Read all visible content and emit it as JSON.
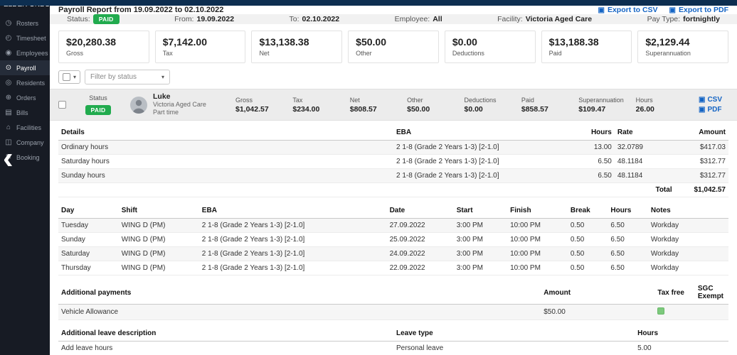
{
  "app": {
    "brand": "ELDER ONBO"
  },
  "icons": {
    "file": "▣",
    "caret_down": "▾",
    "collapse_chevron": "‹"
  },
  "sidebar": {
    "items": [
      {
        "label": "Rosters",
        "icon": "rosters-icon",
        "glyph": "◷"
      },
      {
        "label": "Timesheet",
        "icon": "timesheet-icon",
        "glyph": "◴"
      },
      {
        "label": "Employees",
        "icon": "employees-icon",
        "glyph": "◉"
      },
      {
        "label": "Payroll",
        "icon": "payroll-icon",
        "glyph": "⊙"
      },
      {
        "label": "Residents",
        "icon": "residents-icon",
        "glyph": "◎"
      },
      {
        "label": "Orders",
        "icon": "orders-icon",
        "glyph": "⊕"
      },
      {
        "label": "Bills",
        "icon": "bills-icon",
        "glyph": "▤"
      },
      {
        "label": "Facilities",
        "icon": "facilities-icon",
        "glyph": "⌂"
      },
      {
        "label": "Company",
        "icon": "company-icon",
        "glyph": "◫"
      },
      {
        "label": "Booking",
        "icon": "booking-icon",
        "glyph": "✎"
      }
    ]
  },
  "header": {
    "title": "Payroll Report from 19.09.2022 to 02.10.2022",
    "export_csv": "Export to CSV",
    "export_pdf": "Export to PDF"
  },
  "filters": {
    "status_label": "Status:",
    "status_value": "PAID",
    "from_label": "From:",
    "from_value": "19.09.2022",
    "to_label": "To:",
    "to_value": "02.10.2022",
    "employee_label": "Employee:",
    "employee_value": "All",
    "facility_label": "Facility:",
    "facility_value": "Victoria Aged Care",
    "paytype_label": "Pay Type:",
    "paytype_value": "fortnightly"
  },
  "summary_cards": [
    {
      "value": "$20,280.38",
      "label": "Gross"
    },
    {
      "value": "$7,142.00",
      "label": "Tax"
    },
    {
      "value": "$13,138.38",
      "label": "Net"
    },
    {
      "value": "$50.00",
      "label": "Other"
    },
    {
      "value": "$0.00",
      "label": "Deductions"
    },
    {
      "value": "$13,188.38",
      "label": "Paid"
    },
    {
      "value": "$2,129.44",
      "label": "Superannuation"
    }
  ],
  "toolbar": {
    "filter_placeholder": "Filter by status"
  },
  "employee": {
    "status_label": "Status",
    "status_badge": "PAID",
    "name": "Luke",
    "facility": "Victoria Aged Care",
    "employment": "Part time",
    "metrics": [
      {
        "label": "Gross",
        "value": "$1,042.57"
      },
      {
        "label": "Tax",
        "value": "$234.00"
      },
      {
        "label": "Net",
        "value": "$808.57"
      },
      {
        "label": "Other",
        "value": "$50.00"
      },
      {
        "label": "Deductions",
        "value": "$0.00"
      },
      {
        "label": "Paid",
        "value": "$858.57"
      },
      {
        "label": "Superannuation",
        "value": "$109.47"
      },
      {
        "label": "Hours",
        "value": "26.00"
      }
    ],
    "csv_label": "CSV",
    "pdf_label": "PDF"
  },
  "details_table": {
    "headers": [
      "Details",
      "EBA",
      "Hours",
      "Rate",
      "Amount"
    ],
    "rows": [
      [
        "Ordinary hours",
        "2 1-8 (Grade 2 Years 1-3) [2-1.0]",
        "13.00",
        "32.0789",
        "$417.03"
      ],
      [
        "Saturday hours",
        "2 1-8 (Grade 2 Years 1-3) [2-1.0]",
        "6.50",
        "48.1184",
        "$312.77"
      ],
      [
        "Sunday hours",
        "2 1-8 (Grade 2 Years 1-3) [2-1.0]",
        "6.50",
        "48.1184",
        "$312.77"
      ]
    ],
    "total_label": "Total",
    "total_value": "$1,042.57"
  },
  "shifts_table": {
    "headers": [
      "Day",
      "Shift",
      "EBA",
      "Date",
      "Start",
      "Finish",
      "Break",
      "Hours",
      "Notes"
    ],
    "rows": [
      [
        "Tuesday",
        "WING D (PM)",
        "2 1-8 (Grade 2 Years 1-3) [2-1.0]",
        "27.09.2022",
        "3:00 PM",
        "10:00 PM",
        "0.50",
        "6.50",
        "Workday"
      ],
      [
        "Sunday",
        "WING D (PM)",
        "2 1-8 (Grade 2 Years 1-3) [2-1.0]",
        "25.09.2022",
        "3:00 PM",
        "10:00 PM",
        "0.50",
        "6.50",
        "Workday"
      ],
      [
        "Saturday",
        "WING D (PM)",
        "2 1-8 (Grade 2 Years 1-3) [2-1.0]",
        "24.09.2022",
        "3:00 PM",
        "10:00 PM",
        "0.50",
        "6.50",
        "Workday"
      ],
      [
        "Thursday",
        "WING D (PM)",
        "2 1-8 (Grade 2 Years 1-3) [2-1.0]",
        "22.09.2022",
        "3:00 PM",
        "10:00 PM",
        "0.50",
        "6.50",
        "Workday"
      ]
    ]
  },
  "payments_table": {
    "headers": [
      "Additional payments",
      "Amount",
      "Tax free",
      "SGC Exempt"
    ],
    "rows": [
      {
        "name": "Vehicle Allowance",
        "amount": "$50.00",
        "tax_free_checked": true,
        "sgc_exempt_checked": false
      }
    ]
  },
  "leave_table": {
    "headers": [
      "Additional leave  description",
      "Leave type",
      "Hours"
    ],
    "rows": [
      [
        "Add leave hours",
        "Personal leave",
        "5.00"
      ]
    ]
  }
}
